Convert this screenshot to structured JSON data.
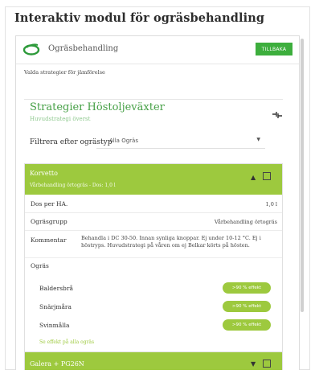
{
  "page": {
    "title": "Interaktiv modul för ogräsbehandling"
  },
  "header": {
    "title": "Ogräsbehandling",
    "back_label": "TILLBAKA"
  },
  "selected": {
    "label": "Valda strategier för jämförelse"
  },
  "strategy": {
    "title": "Strategier Höstoljeväxter",
    "subtitle": "Huvudstrategi överst"
  },
  "filter": {
    "label": "Filtrera efter ogrästyp",
    "value": "Alla Ogräs"
  },
  "cards": [
    {
      "name": "Korvetto",
      "meta": "Vårbehandling örtogräs - Dos: 1,0 l",
      "rows": {
        "dose_label": "Dos per HA.",
        "dose_value": "1,0 l",
        "group_label": "Ogräsgrupp",
        "group_value": "Vårbehandling örtogräs",
        "comment_label": "Kommentar",
        "comment_value": "Behandla i DC 30-50. Innan synliga knoppar. Ej under 10-12 °C. Ej i höstryps. Huvudstrategi på våren om ej Belkar körts på hösten.",
        "weeds_label": "Ogräs"
      },
      "weeds": [
        {
          "name": "Baldersbrå",
          "effect": ">90 % effekt"
        },
        {
          "name": "Snärjmåra",
          "effect": ">90 % effekt"
        },
        {
          "name": "Svinmålla",
          "effect": ">90 % effekt"
        }
      ],
      "more_link": "Se effekt på alla ogräs"
    },
    {
      "name": "Galera + PG26N"
    }
  ],
  "colors": {
    "accent": "#9dc93e",
    "button": "#3dae3d",
    "title_green": "#46a046"
  }
}
